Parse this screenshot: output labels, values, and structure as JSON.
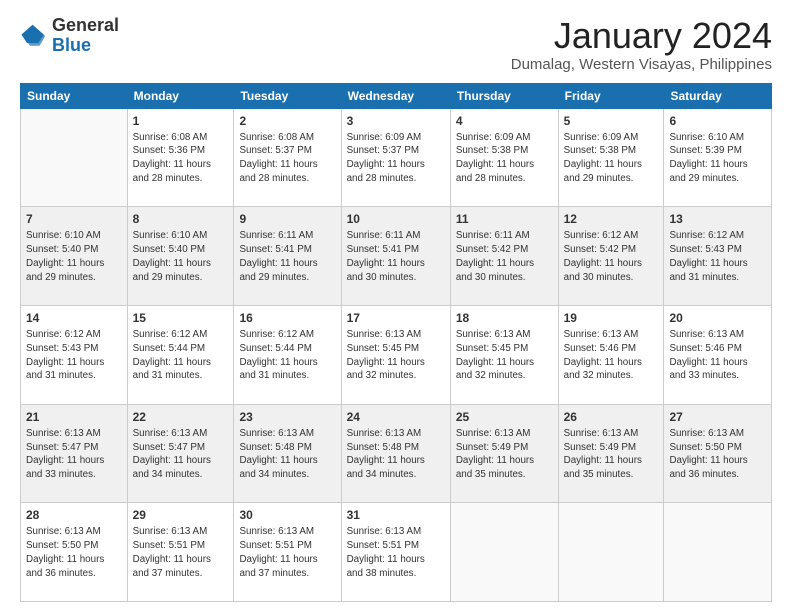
{
  "logo": {
    "general": "General",
    "blue": "Blue"
  },
  "title": "January 2024",
  "subtitle": "Dumalag, Western Visayas, Philippines",
  "days_header": [
    "Sunday",
    "Monday",
    "Tuesday",
    "Wednesday",
    "Thursday",
    "Friday",
    "Saturday"
  ],
  "weeks": [
    [
      {
        "num": "",
        "detail": ""
      },
      {
        "num": "1",
        "detail": "Sunrise: 6:08 AM\nSunset: 5:36 PM\nDaylight: 11 hours\nand 28 minutes."
      },
      {
        "num": "2",
        "detail": "Sunrise: 6:08 AM\nSunset: 5:37 PM\nDaylight: 11 hours\nand 28 minutes."
      },
      {
        "num": "3",
        "detail": "Sunrise: 6:09 AM\nSunset: 5:37 PM\nDaylight: 11 hours\nand 28 minutes."
      },
      {
        "num": "4",
        "detail": "Sunrise: 6:09 AM\nSunset: 5:38 PM\nDaylight: 11 hours\nand 28 minutes."
      },
      {
        "num": "5",
        "detail": "Sunrise: 6:09 AM\nSunset: 5:38 PM\nDaylight: 11 hours\nand 29 minutes."
      },
      {
        "num": "6",
        "detail": "Sunrise: 6:10 AM\nSunset: 5:39 PM\nDaylight: 11 hours\nand 29 minutes."
      }
    ],
    [
      {
        "num": "7",
        "detail": "Sunrise: 6:10 AM\nSunset: 5:40 PM\nDaylight: 11 hours\nand 29 minutes."
      },
      {
        "num": "8",
        "detail": "Sunrise: 6:10 AM\nSunset: 5:40 PM\nDaylight: 11 hours\nand 29 minutes."
      },
      {
        "num": "9",
        "detail": "Sunrise: 6:11 AM\nSunset: 5:41 PM\nDaylight: 11 hours\nand 29 minutes."
      },
      {
        "num": "10",
        "detail": "Sunrise: 6:11 AM\nSunset: 5:41 PM\nDaylight: 11 hours\nand 30 minutes."
      },
      {
        "num": "11",
        "detail": "Sunrise: 6:11 AM\nSunset: 5:42 PM\nDaylight: 11 hours\nand 30 minutes."
      },
      {
        "num": "12",
        "detail": "Sunrise: 6:12 AM\nSunset: 5:42 PM\nDaylight: 11 hours\nand 30 minutes."
      },
      {
        "num": "13",
        "detail": "Sunrise: 6:12 AM\nSunset: 5:43 PM\nDaylight: 11 hours\nand 31 minutes."
      }
    ],
    [
      {
        "num": "14",
        "detail": "Sunrise: 6:12 AM\nSunset: 5:43 PM\nDaylight: 11 hours\nand 31 minutes."
      },
      {
        "num": "15",
        "detail": "Sunrise: 6:12 AM\nSunset: 5:44 PM\nDaylight: 11 hours\nand 31 minutes."
      },
      {
        "num": "16",
        "detail": "Sunrise: 6:12 AM\nSunset: 5:44 PM\nDaylight: 11 hours\nand 31 minutes."
      },
      {
        "num": "17",
        "detail": "Sunrise: 6:13 AM\nSunset: 5:45 PM\nDaylight: 11 hours\nand 32 minutes."
      },
      {
        "num": "18",
        "detail": "Sunrise: 6:13 AM\nSunset: 5:45 PM\nDaylight: 11 hours\nand 32 minutes."
      },
      {
        "num": "19",
        "detail": "Sunrise: 6:13 AM\nSunset: 5:46 PM\nDaylight: 11 hours\nand 32 minutes."
      },
      {
        "num": "20",
        "detail": "Sunrise: 6:13 AM\nSunset: 5:46 PM\nDaylight: 11 hours\nand 33 minutes."
      }
    ],
    [
      {
        "num": "21",
        "detail": "Sunrise: 6:13 AM\nSunset: 5:47 PM\nDaylight: 11 hours\nand 33 minutes."
      },
      {
        "num": "22",
        "detail": "Sunrise: 6:13 AM\nSunset: 5:47 PM\nDaylight: 11 hours\nand 34 minutes."
      },
      {
        "num": "23",
        "detail": "Sunrise: 6:13 AM\nSunset: 5:48 PM\nDaylight: 11 hours\nand 34 minutes."
      },
      {
        "num": "24",
        "detail": "Sunrise: 6:13 AM\nSunset: 5:48 PM\nDaylight: 11 hours\nand 34 minutes."
      },
      {
        "num": "25",
        "detail": "Sunrise: 6:13 AM\nSunset: 5:49 PM\nDaylight: 11 hours\nand 35 minutes."
      },
      {
        "num": "26",
        "detail": "Sunrise: 6:13 AM\nSunset: 5:49 PM\nDaylight: 11 hours\nand 35 minutes."
      },
      {
        "num": "27",
        "detail": "Sunrise: 6:13 AM\nSunset: 5:50 PM\nDaylight: 11 hours\nand 36 minutes."
      }
    ],
    [
      {
        "num": "28",
        "detail": "Sunrise: 6:13 AM\nSunset: 5:50 PM\nDaylight: 11 hours\nand 36 minutes."
      },
      {
        "num": "29",
        "detail": "Sunrise: 6:13 AM\nSunset: 5:51 PM\nDaylight: 11 hours\nand 37 minutes."
      },
      {
        "num": "30",
        "detail": "Sunrise: 6:13 AM\nSunset: 5:51 PM\nDaylight: 11 hours\nand 37 minutes."
      },
      {
        "num": "31",
        "detail": "Sunrise: 6:13 AM\nSunset: 5:51 PM\nDaylight: 11 hours\nand 38 minutes."
      },
      {
        "num": "",
        "detail": ""
      },
      {
        "num": "",
        "detail": ""
      },
      {
        "num": "",
        "detail": ""
      }
    ]
  ]
}
